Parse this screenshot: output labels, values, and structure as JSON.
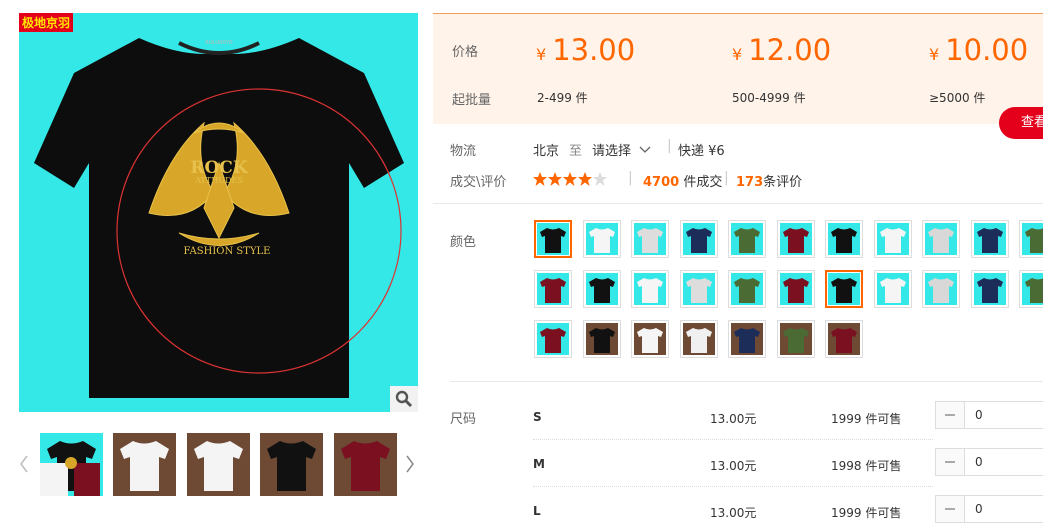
{
  "gallery": {
    "brand_tag": "极地京羽",
    "shirt_text": {
      "line1": "ROCK",
      "line2": "ATTHUDES",
      "line3": "FASHION STYLE",
      "collar": "ROLUNSYO"
    },
    "thumbnails": [
      {
        "bg": "cyan",
        "shirt": "mixed"
      },
      {
        "bg": "brown",
        "shirt": "white"
      },
      {
        "bg": "brown",
        "shirt": "white"
      },
      {
        "bg": "brown",
        "shirt": "black"
      },
      {
        "bg": "brown",
        "shirt": "maroon"
      }
    ]
  },
  "price": {
    "price_label": "价格",
    "batch_label": "起批量",
    "tiers": [
      {
        "currency": "¥",
        "amount": "13.00",
        "range": "2-499 件"
      },
      {
        "currency": "¥",
        "amount": "12.00",
        "range": "500-4999 件"
      },
      {
        "currency": "¥",
        "amount": "10.00",
        "range": "≥5000 件"
      }
    ],
    "view_button": "查看"
  },
  "logistics": {
    "label": "物流",
    "from": "北京",
    "to_word": "至",
    "select": "请选择",
    "express": "快递 ¥6"
  },
  "deals": {
    "label": "成交\\评价",
    "rating": 4.5,
    "deal_count": "4700",
    "deal_suffix": "件成交",
    "review_count": "173",
    "review_suffix": "条评价"
  },
  "colors": {
    "label": "颜色",
    "swatches": [
      {
        "bg": "#33e8e6",
        "shirt": "#111111"
      },
      {
        "bg": "#33e8e6",
        "shirt": "#f5f5f5"
      },
      {
        "bg": "#33e8e6",
        "shirt": "#dddddd"
      },
      {
        "bg": "#33e8e6",
        "shirt": "#1c2d5a"
      },
      {
        "bg": "#33e8e6",
        "shirt": "#4b6b35"
      },
      {
        "bg": "#33e8e6",
        "shirt": "#7a1020"
      },
      {
        "bg": "#33e8e6",
        "shirt": "#111111"
      },
      {
        "bg": "#33e8e6",
        "shirt": "#f5f5f5"
      },
      {
        "bg": "#33e8e6",
        "shirt": "#d8d8d8"
      },
      {
        "bg": "#33e8e6",
        "shirt": "#1c2d5a"
      },
      {
        "bg": "#33e8e6",
        "shirt": "#4b6b35"
      },
      {
        "bg": "#33e8e6",
        "shirt": "#7a1020"
      },
      {
        "bg": "#33e8e6",
        "shirt": "#111111"
      },
      {
        "bg": "#33e8e6",
        "shirt": "#f5f5f5"
      },
      {
        "bg": "#33e8e6",
        "shirt": "#dddddd"
      },
      {
        "bg": "#33e8e6",
        "shirt": "#4b6b35"
      },
      {
        "bg": "#33e8e6",
        "shirt": "#7a1020"
      },
      {
        "bg": "#33e8e6",
        "shirt": "#111111"
      },
      {
        "bg": "#33e8e6",
        "shirt": "#f5f5f5"
      },
      {
        "bg": "#33e8e6",
        "shirt": "#d8d8d8"
      },
      {
        "bg": "#33e8e6",
        "shirt": "#1c2d5a"
      },
      {
        "bg": "#33e8e6",
        "shirt": "#4b6b35"
      },
      {
        "bg": "#33e8e6",
        "shirt": "#7a1020"
      },
      {
        "bg": "#6e4a35",
        "shirt": "#111111"
      },
      {
        "bg": "#6e4a35",
        "shirt": "#f5f5f5"
      },
      {
        "bg": "#6e4a35",
        "shirt": "#f0f0f0"
      },
      {
        "bg": "#6e4a35",
        "shirt": "#1c2d5a"
      },
      {
        "bg": "#6e4a35",
        "shirt": "#4b6b35"
      },
      {
        "bg": "#6e4a35",
        "shirt": "#7a1020"
      }
    ],
    "selected": [
      0,
      17
    ]
  },
  "sizes": {
    "label": "尺码",
    "rows": [
      {
        "name": "S",
        "price": "13.00元",
        "stock": "1999 件可售",
        "qty": "0"
      },
      {
        "name": "M",
        "price": "13.00元",
        "stock": "1998 件可售",
        "qty": "0"
      },
      {
        "name": "L",
        "price": "13.00元",
        "stock": "1999 件可售",
        "qty": "0"
      }
    ]
  }
}
